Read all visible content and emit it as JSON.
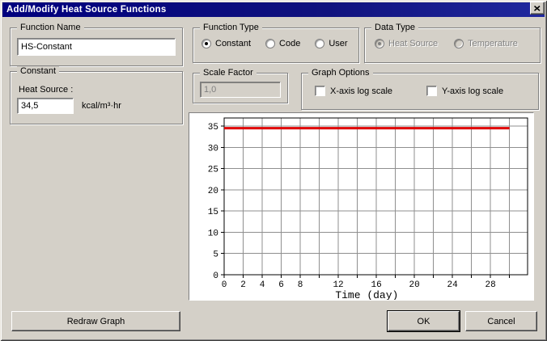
{
  "window": {
    "title": "Add/Modify Heat Source Functions"
  },
  "function_name": {
    "label": "Function Name",
    "value": "HS-Constant"
  },
  "constant_group": {
    "label": "Constant",
    "field_label": "Heat Source :",
    "value": "34,5",
    "unit": "kcal/m³·hr"
  },
  "function_type": {
    "label": "Function Type",
    "disabled": false,
    "options": [
      {
        "label": "Constant",
        "selected": true
      },
      {
        "label": "Code",
        "selected": false
      },
      {
        "label": "User",
        "selected": false
      }
    ]
  },
  "data_type": {
    "label": "Data Type",
    "disabled": true,
    "options": [
      {
        "label": "Heat Source",
        "selected": true
      },
      {
        "label": "Temperature",
        "selected": false
      }
    ]
  },
  "scale_factor": {
    "label": "Scale Factor",
    "value": "1,0",
    "disabled": true
  },
  "graph_options": {
    "label": "Graph Options",
    "checkboxes": [
      {
        "label": "X-axis log scale",
        "checked": false
      },
      {
        "label": "Y-axis log scale",
        "checked": false
      }
    ]
  },
  "buttons": {
    "redraw": "Redraw Graph",
    "ok": "OK",
    "cancel": "Cancel"
  },
  "chart_data": {
    "type": "line",
    "title": "",
    "xlabel": "Time (day)",
    "ylabel": "",
    "xlim": [
      0,
      31.9
    ],
    "ylim": [
      0,
      36.9
    ],
    "x_ticks": [
      0,
      2,
      4,
      6,
      8,
      10,
      12,
      14,
      16,
      18,
      20,
      22,
      24,
      26,
      28,
      30
    ],
    "x_tick_labels": [
      "0",
      "2",
      "4",
      "6",
      "8",
      "",
      "12",
      "",
      "16",
      "",
      "20",
      "",
      "24",
      "",
      "28",
      ""
    ],
    "y_ticks": [
      0,
      5,
      10,
      15,
      20,
      25,
      30,
      35
    ],
    "grid": true,
    "grid_color": "#8f8f8f",
    "frame_color": "#000000",
    "background": "#ffffff",
    "legend": "none",
    "series": [
      {
        "name": "Heat Source",
        "color": "#e00000",
        "width": 3,
        "x": [
          0,
          30
        ],
        "y": [
          34.5,
          34.5
        ]
      }
    ]
  }
}
